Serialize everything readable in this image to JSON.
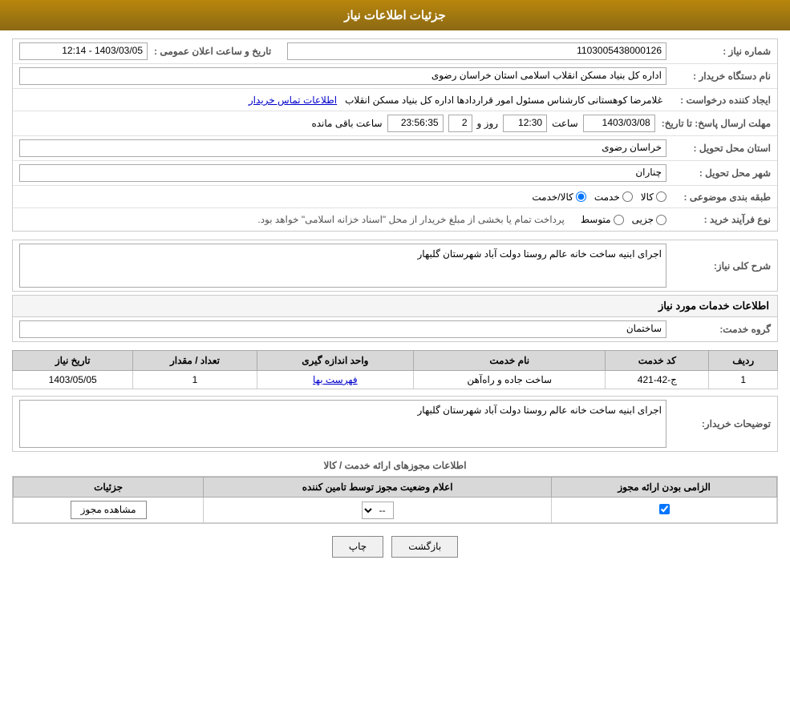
{
  "header": {
    "title": "جزئیات اطلاعات نیاز"
  },
  "fields": {
    "needNumber_label": "شماره نیاز :",
    "needNumber_value": "1103005438000126",
    "buyerOrg_label": "نام دستگاه خریدار :",
    "buyerOrg_value": "اداره کل بنیاد مسکن انقلاب اسلامی استان خراسان رضوی",
    "creator_label": "ایجاد کننده درخواست :",
    "creator_value": "غلامرضا کوهستانی کارشناس مسئول امور قراردادها اداره کل بنیاد مسکن انقلاب",
    "creator_link": "اطلاعات تماس خریدار",
    "sendDate_label": "مهلت ارسال پاسخ: تا تاریخ:",
    "date_value": "1403/03/08",
    "time_label": "ساعت",
    "time_value": "12:30",
    "day_label": "روز و",
    "day_value": "2",
    "remaining_value": "23:56:35",
    "remaining_label": "ساعت باقی مانده",
    "province_label": "استان محل تحویل :",
    "province_value": "خراسان رضوی",
    "city_label": "شهر محل تحویل :",
    "city_value": "چناران",
    "category_label": "طبقه بندی موضوعی :",
    "category_kala": "کالا",
    "category_khadamat": "خدمت",
    "category_kala_khadamat": "کالا/خدمت",
    "buyType_label": "نوع فرآیند خرید :",
    "buyType_jozei": "جزیی",
    "buyType_motawaset": "متوسط",
    "buyType_desc": "پرداخت تمام یا بخشی از مبلغ خریدار از محل \"اسناد خزانه اسلامی\" خواهد بود.",
    "announcement_label": "تاریخ و ساعت اعلان عمومی :",
    "announcement_value": "1403/03/05 - 12:14",
    "description_label": "شرح کلی نیاز:",
    "description_value": "اجرای ابنیه ساخت خانه عالم روستا دولت آباد شهرستان گلبهار"
  },
  "services_section": {
    "title": "اطلاعات خدمات مورد نیاز",
    "group_label": "گروه خدمت:",
    "group_value": "ساختمان",
    "table_headers": [
      "ردیف",
      "کد خدمت",
      "نام خدمت",
      "واحد اندازه گیری",
      "تعداد / مقدار",
      "تاریخ نیاز"
    ],
    "table_rows": [
      {
        "row": "1",
        "code": "ج-42-421",
        "name": "ساخت جاده و راه‌آهن",
        "unit": "فهرست بها",
        "count": "1",
        "date": "1403/05/05"
      }
    ]
  },
  "buyer_notes_label": "توضیحات خریدار:",
  "buyer_notes_value": "اجرای ابنیه ساخت خانه عالم روستا دولت آباد شهرستان گلبهار",
  "permissions_section": {
    "separator": "اطلاعات مجوزهای ارائه خدمت / کالا",
    "table_headers": [
      "الزامی بودن ارائه مجوز",
      "اعلام وضعیت مجوز توسط تامین کننده",
      "جزئیات"
    ],
    "table_rows": [
      {
        "required": true,
        "status": "--",
        "details_btn": "مشاهده مجوز"
      }
    ]
  },
  "buttons": {
    "print": "چاپ",
    "back": "بازگشت"
  }
}
